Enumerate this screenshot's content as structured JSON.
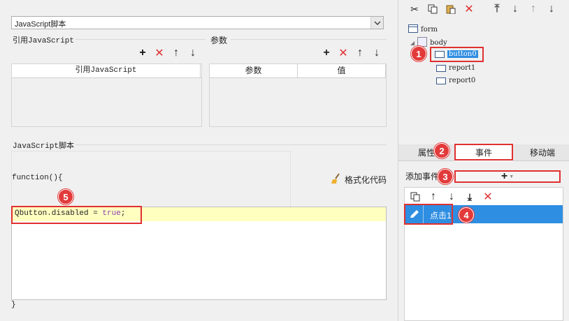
{
  "left": {
    "script_type_select": "JavaScript脚本",
    "ref_js_section_label": "引用JavaScript",
    "params_section_label": "参数",
    "ref_js_table_header": "引用JavaScript",
    "params_table_headers": [
      "参数",
      "值"
    ],
    "js_script_section_label": "JavaScript脚本",
    "function_open": "function(){",
    "code_line": "Qbutton.disabled = true;",
    "code_keyword": "true",
    "function_close": "}",
    "format_code_button": "格式化代码"
  },
  "right": {
    "tree": {
      "form": "form",
      "body": "body",
      "button0": "button0",
      "report1": "report1",
      "report0": "report0"
    },
    "tabs": [
      "属性",
      "事件",
      "移动端"
    ],
    "add_event_label": "添加事件",
    "event_item_label": "点击1"
  },
  "badges": [
    "1",
    "2",
    "3",
    "4",
    "5"
  ],
  "colors": {
    "highlight_red": "#e03030",
    "selected_blue": "#2e8ee2",
    "code_highlight": "#ffffc0"
  }
}
